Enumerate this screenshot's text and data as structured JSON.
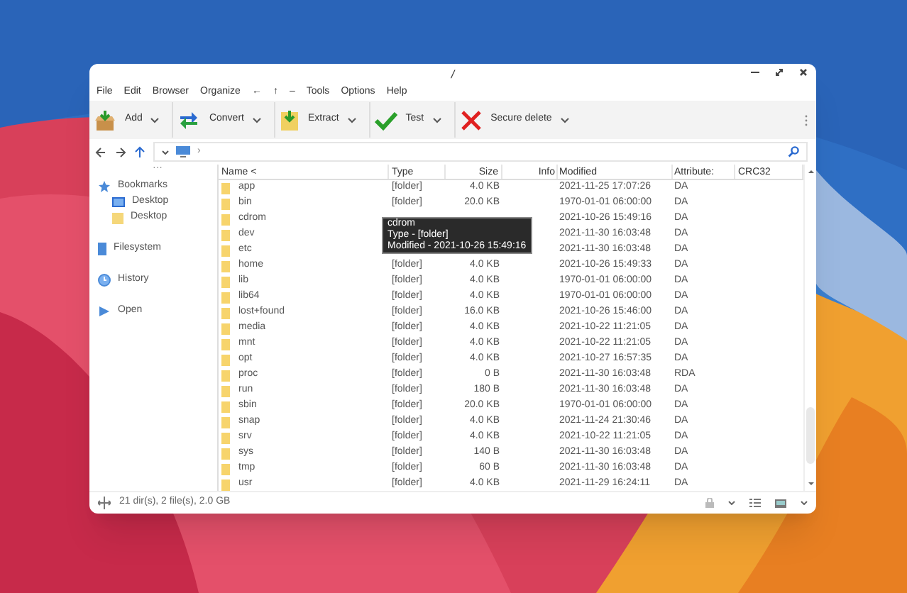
{
  "window": {
    "title": "/"
  },
  "menu": [
    "File",
    "Edit",
    "Browser",
    "Organize",
    "←",
    "↑",
    "–",
    "Tools",
    "Options",
    "Help"
  ],
  "toolbar": [
    {
      "kind": "add",
      "label": "Add"
    },
    {
      "kind": "convert",
      "label": "Convert"
    },
    {
      "kind": "extract",
      "label": "Extract"
    },
    {
      "kind": "test",
      "label": "Test"
    },
    {
      "kind": "delete",
      "label": "Secure delete"
    }
  ],
  "address": {
    "path": "›"
  },
  "sidebar": {
    "more": "···",
    "items": [
      {
        "kind": "bookmarks",
        "label": "Bookmarks",
        "children": [
          {
            "kind": "desktop-blue",
            "label": "Desktop"
          },
          {
            "kind": "desktop-folder",
            "label": "Desktop"
          }
        ]
      },
      {
        "kind": "filesystem",
        "label": "Filesystem"
      },
      {
        "kind": "history",
        "label": "History"
      },
      {
        "kind": "open",
        "label": "Open"
      }
    ]
  },
  "table": {
    "columns": [
      "Name <",
      "Type",
      "Size",
      "Info",
      "Modified",
      "Attribute:",
      "CRC32"
    ],
    "rows": [
      {
        "name": "app",
        "type": "[folder]",
        "size": "4.0 KB",
        "modified": "2021-11-25 17:07:26",
        "attributes": "DA"
      },
      {
        "name": "bin",
        "type": "[folder]",
        "size": "20.0 KB",
        "modified": "1970-01-01 06:00:00",
        "attributes": "DA"
      },
      {
        "name": "cdrom",
        "modified": "2021-10-26 15:49:16",
        "attributes": "DA"
      },
      {
        "name": "dev",
        "modified": "2021-11-30 16:03:48",
        "attributes": "DA"
      },
      {
        "name": "etc",
        "modified": "2021-11-30 16:03:48",
        "attributes": "DA"
      },
      {
        "name": "home",
        "type": "[folder]",
        "size": "4.0 KB",
        "modified": "2021-10-26 15:49:33",
        "attributes": "DA"
      },
      {
        "name": "lib",
        "type": "[folder]",
        "size": "4.0 KB",
        "modified": "1970-01-01 06:00:00",
        "attributes": "DA"
      },
      {
        "name": "lib64",
        "type": "[folder]",
        "size": "4.0 KB",
        "modified": "1970-01-01 06:00:00",
        "attributes": "DA"
      },
      {
        "name": "lost+found",
        "type": "[folder]",
        "size": "16.0 KB",
        "modified": "2021-10-26 15:46:00",
        "attributes": "DA"
      },
      {
        "name": "media",
        "type": "[folder]",
        "size": "4.0 KB",
        "modified": "2021-10-22 11:21:05",
        "attributes": "DA"
      },
      {
        "name": "mnt",
        "type": "[folder]",
        "size": "4.0 KB",
        "modified": "2021-10-22 11:21:05",
        "attributes": "DA"
      },
      {
        "name": "opt",
        "type": "[folder]",
        "size": "4.0 KB",
        "modified": "2021-10-27 16:57:35",
        "attributes": "DA"
      },
      {
        "name": "proc",
        "type": "[folder]",
        "size": "0 B",
        "modified": "2021-11-30 16:03:48",
        "attributes": "RDA"
      },
      {
        "name": "run",
        "type": "[folder]",
        "size": "180 B",
        "modified": "2021-11-30 16:03:48",
        "attributes": "DA"
      },
      {
        "name": "sbin",
        "type": "[folder]",
        "size": "20.0 KB",
        "modified": "1970-01-01 06:00:00",
        "attributes": "DA"
      },
      {
        "name": "snap",
        "type": "[folder]",
        "size": "4.0 KB",
        "modified": "2021-11-24 21:30:46",
        "attributes": "DA"
      },
      {
        "name": "srv",
        "type": "[folder]",
        "size": "4.0 KB",
        "modified": "2021-10-22 11:21:05",
        "attributes": "DA"
      },
      {
        "name": "sys",
        "type": "[folder]",
        "size": "140 B",
        "modified": "2021-11-30 16:03:48",
        "attributes": "DA"
      },
      {
        "name": "tmp",
        "type": "[folder]",
        "size": "60 B",
        "modified": "2021-11-30 16:03:48",
        "attributes": "DA"
      },
      {
        "name": "usr",
        "type": "[folder]",
        "size": "4.0 KB",
        "modified": "2021-11-29 16:24:11",
        "attributes": "DA"
      }
    ]
  },
  "tooltip": [
    "cdrom",
    "Type -  [folder]",
    "Modified - 2021-10-26 15:49:16"
  ],
  "status_bar": {
    "text": "21 dir(s), 2 file(s), 2.0 GB"
  }
}
